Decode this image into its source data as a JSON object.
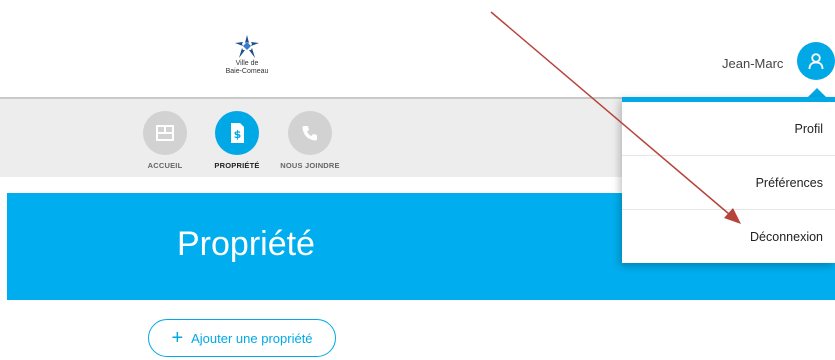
{
  "header": {
    "logo_line1": "Ville de",
    "logo_line2": "Baie-Comeau",
    "user_name": "Jean-Marc"
  },
  "nav": {
    "items": [
      {
        "label": "ACCUEIL",
        "icon": "home-grid-icon"
      },
      {
        "label": "PROPRIÉTÉ",
        "icon": "property-dollar-icon"
      },
      {
        "label": "NOUS JOINDRE",
        "icon": "phone-icon"
      }
    ],
    "active_index": 1
  },
  "banner": {
    "title": "Propriété"
  },
  "add_property": {
    "plus": "+",
    "label": "Ajouter une propriété"
  },
  "user_menu": {
    "items": [
      "Profil",
      "Préférences",
      "Déconnexion"
    ]
  },
  "colors": {
    "accent": "#00a9e6",
    "banner": "#00aeef",
    "nav_bg": "#ededed",
    "inactive_icon": "#d2d2d2",
    "annotation_arrow": "#b5453c"
  }
}
